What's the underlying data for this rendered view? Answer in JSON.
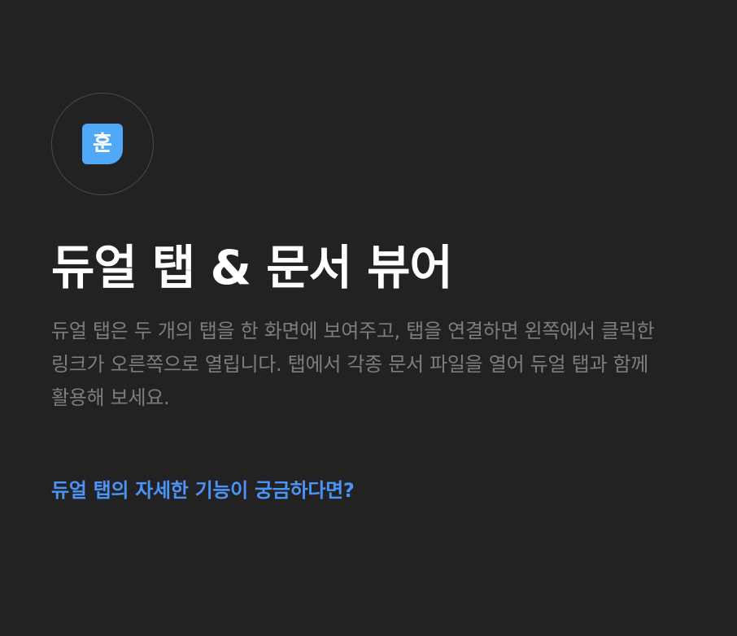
{
  "logo": {
    "icon": "hangul-hoon-logo-icon",
    "glyph": "훈",
    "color": "#4fa9f7"
  },
  "header": {
    "title": "듀얼 탭 & 문서 뷰어"
  },
  "main": {
    "description": "듀얼 탭은 두 개의 탭을 한 화면에 보여주고, 탭을 연결하면 왼쪽에서 클릭한 링크가 오른쪽으로 열립니다. 탭에서 각종 문서 파일을 열어 듀얼 탭과 함께 활용해 보세요.",
    "link_label": "듀얼 탭의 자세한 기능이 궁금하다면?",
    "link_color": "#4b93f5"
  },
  "theme": {
    "background": "#222223",
    "title_color": "#ffffff",
    "text_color": "#7d7d80"
  }
}
